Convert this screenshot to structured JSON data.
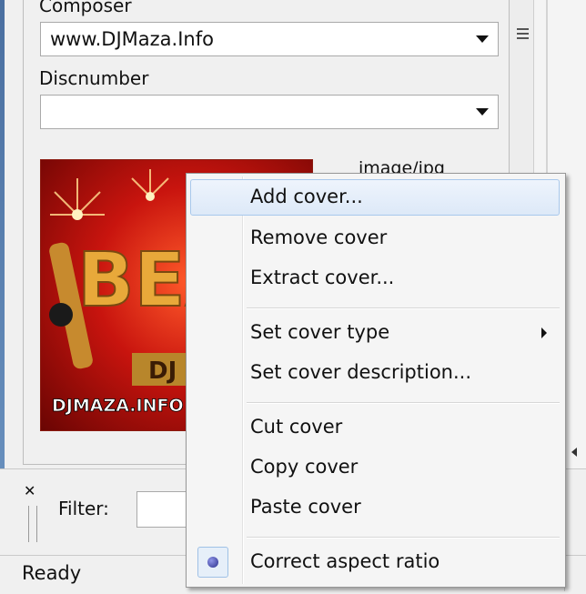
{
  "form": {
    "composer": {
      "label": "Composer",
      "value": "www.DJMaza.Info"
    },
    "discnumber": {
      "label": "Discnumber",
      "value": ""
    }
  },
  "cover": {
    "mime_type": "image/jpg",
    "image_text": [
      "BEAT",
      "DJ DE",
      "DJMAZA.INFO"
    ]
  },
  "filter": {
    "label": "Filter:",
    "value": ""
  },
  "status": {
    "text": "Ready"
  },
  "context_menu": {
    "items": [
      {
        "label": "Add cover...",
        "highlighted": true
      },
      {
        "label": "Remove cover"
      },
      {
        "label": "Extract cover..."
      },
      {
        "label": "Set cover type",
        "has_submenu": true
      },
      {
        "label": "Set cover description..."
      },
      {
        "label": "Cut cover"
      },
      {
        "label": "Copy cover"
      },
      {
        "label": "Paste cover"
      },
      {
        "label": "Correct aspect ratio",
        "checked": true
      }
    ]
  },
  "colors": {
    "menu_highlight": "#dde9f8",
    "menu_highlight_border": "#a8c8ec",
    "cover_red": "#c8140e",
    "cover_gold": "#e8a93a"
  },
  "icons": [
    "close-icon",
    "splitter-grip-icon",
    "dropdown-arrow-icon",
    "submenu-arrow-icon",
    "radio-checked-icon",
    "list-grip-icon"
  ]
}
